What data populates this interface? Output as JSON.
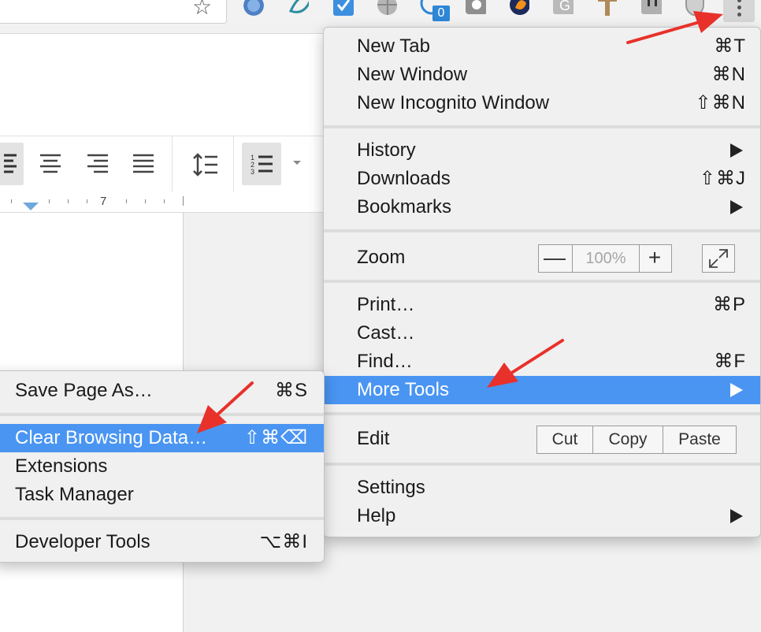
{
  "toolbar": {
    "bookmark_icon": "star-icon",
    "extension_badge": "0",
    "menu_icon": "kebab-icon"
  },
  "docs": {
    "ruler_number": "7"
  },
  "main_menu": {
    "new_tab": {
      "label": "New Tab",
      "shortcut": "⌘T"
    },
    "new_window": {
      "label": "New Window",
      "shortcut": "⌘N"
    },
    "new_incognito": {
      "label": "New Incognito Window",
      "shortcut": "⇧⌘N"
    },
    "history": {
      "label": "History"
    },
    "downloads": {
      "label": "Downloads",
      "shortcut": "⇧⌘J"
    },
    "bookmarks": {
      "label": "Bookmarks"
    },
    "zoom": {
      "label": "Zoom",
      "minus": "—",
      "value": "100%",
      "plus": "+"
    },
    "print": {
      "label": "Print…",
      "shortcut": "⌘P"
    },
    "cast": {
      "label": "Cast…"
    },
    "find": {
      "label": "Find…",
      "shortcut": "⌘F"
    },
    "more_tools": {
      "label": "More Tools"
    },
    "edit": {
      "label": "Edit",
      "cut": "Cut",
      "copy": "Copy",
      "paste": "Paste"
    },
    "settings": {
      "label": "Settings"
    },
    "help": {
      "label": "Help"
    }
  },
  "sub_menu": {
    "save_page": {
      "label": "Save Page As…",
      "shortcut": "⌘S"
    },
    "clear_data": {
      "label": "Clear Browsing Data…",
      "shortcut": "⇧⌘⌫"
    },
    "extensions": {
      "label": "Extensions"
    },
    "task_manager": {
      "label": "Task Manager"
    },
    "dev_tools": {
      "label": "Developer Tools",
      "shortcut": "⌥⌘I"
    }
  },
  "colors": {
    "highlight": "#4a95f2",
    "annotation_arrow": "#e8312a"
  }
}
